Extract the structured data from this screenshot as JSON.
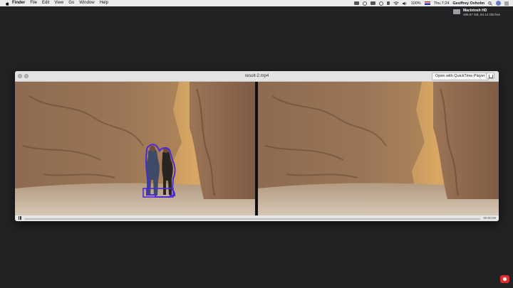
{
  "menubar": {
    "app_name": "Finder",
    "menus": [
      "File",
      "Edit",
      "View",
      "Go",
      "Window",
      "Help"
    ],
    "battery": "100%",
    "clock": "Thu 7:24",
    "user": "Geoffrey Oxholm"
  },
  "desktop": {
    "disk_name": "Macintosh HD",
    "disk_info": "499.97 GB, 94.14 GB free"
  },
  "window": {
    "title": "result-2.mp4",
    "open_button": "Open with QuickTime Player",
    "time": "00:00:09",
    "progress": 0.0
  },
  "colors": {
    "desktop": "#222224",
    "segmentation_outline": "#4b2bd6"
  },
  "icons": [
    "apple-icon",
    "wifi-icon",
    "bluetooth-icon",
    "volume-icon",
    "flag-icon",
    "search-icon",
    "avatar",
    "list-icon",
    "pause-icon",
    "share-icon",
    "record-icon"
  ]
}
